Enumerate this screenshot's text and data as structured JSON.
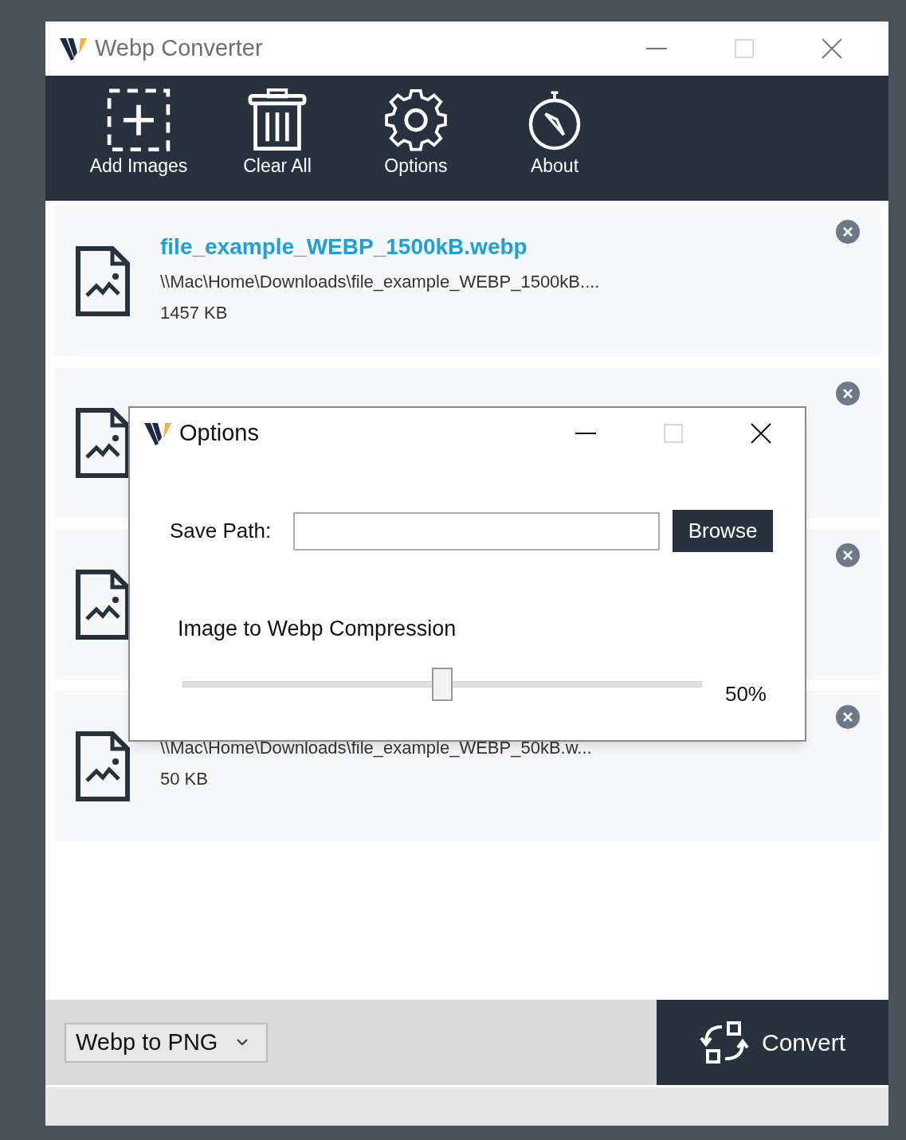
{
  "window": {
    "title": "Webp Converter"
  },
  "toolbar": [
    {
      "kind": "add",
      "label": "Add Images"
    },
    {
      "kind": "clear",
      "label": "Clear All"
    },
    {
      "kind": "options",
      "label": "Options"
    },
    {
      "kind": "about",
      "label": "About"
    }
  ],
  "files": [
    {
      "kind": "image",
      "name": "file_example_WEBP_1500kB.webp",
      "path": "\\\\Mac\\Home\\Downloads\\file_example_WEBP_1500kB....",
      "size": "1457 KB"
    },
    {
      "kind": "image"
    },
    {
      "kind": "image"
    },
    {
      "kind": "image",
      "path": "\\\\Mac\\Home\\Downloads\\file_example_WEBP_50kB.w...",
      "size": "50 KB"
    }
  ],
  "format_select": {
    "value": "Webp to PNG"
  },
  "convert_button": "Convert",
  "options_dialog": {
    "title": "Options",
    "save_path_label": "Save Path:",
    "browse_button": "Browse",
    "compression_label": "Image to Webp Compression",
    "compression": {
      "level": 0.5,
      "reading": "50%"
    }
  }
}
